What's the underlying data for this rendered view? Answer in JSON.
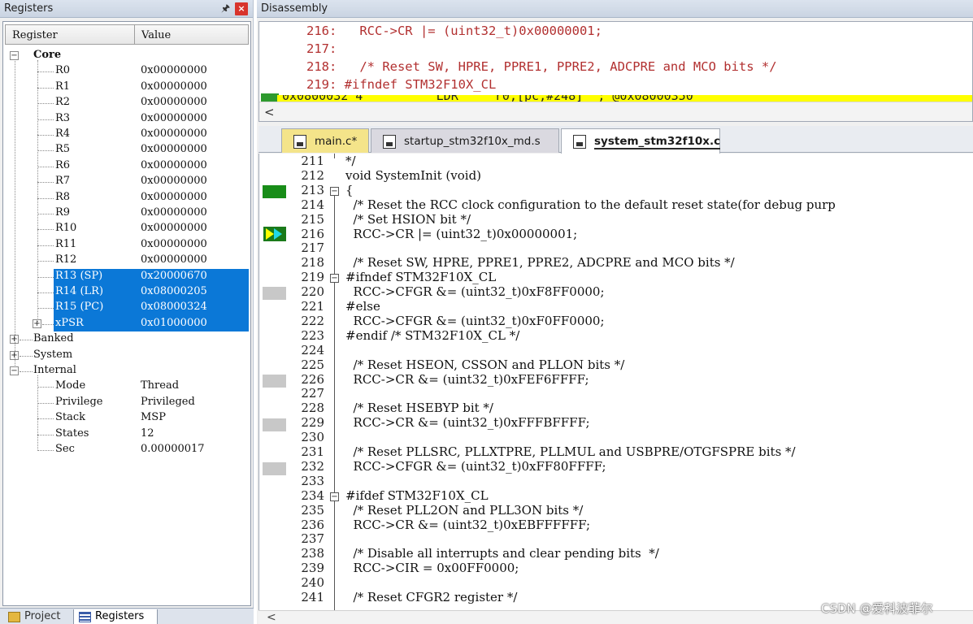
{
  "registers_panel": {
    "title": "Registers",
    "pin_icon": "pin-icon",
    "close_label": "×",
    "columns": {
      "register": "Register",
      "value": "Value"
    },
    "core_label": "Core",
    "core_rows": [
      {
        "name": "R0",
        "value": "0x00000000"
      },
      {
        "name": "R1",
        "value": "0x00000000"
      },
      {
        "name": "R2",
        "value": "0x00000000"
      },
      {
        "name": "R3",
        "value": "0x00000000"
      },
      {
        "name": "R4",
        "value": "0x00000000"
      },
      {
        "name": "R5",
        "value": "0x00000000"
      },
      {
        "name": "R6",
        "value": "0x00000000"
      },
      {
        "name": "R7",
        "value": "0x00000000"
      },
      {
        "name": "R8",
        "value": "0x00000000"
      },
      {
        "name": "R9",
        "value": "0x00000000"
      },
      {
        "name": "R10",
        "value": "0x00000000"
      },
      {
        "name": "R11",
        "value": "0x00000000"
      },
      {
        "name": "R12",
        "value": "0x00000000"
      },
      {
        "name": "R13 (SP)",
        "value": "0x20000670"
      },
      {
        "name": "R14 (LR)",
        "value": "0x08000205"
      },
      {
        "name": "R15 (PC)",
        "value": "0x08000324"
      },
      {
        "name": "xPSR",
        "value": "0x01000000"
      }
    ],
    "groups": {
      "banked": "Banked",
      "system": "System",
      "internal": "Internal"
    },
    "internal_rows": [
      {
        "name": "Mode",
        "value": "Thread"
      },
      {
        "name": "Privilege",
        "value": "Privileged"
      },
      {
        "name": "Stack",
        "value": "MSP"
      },
      {
        "name": "States",
        "value": "12"
      },
      {
        "name": "Sec",
        "value": "0.00000017"
      }
    ],
    "bottom_tabs": {
      "project": "Project",
      "registers": "Registers"
    }
  },
  "disassembly": {
    "title": "Disassembly",
    "lines": [
      "   216:   RCC->CR |= (uint32_t)0x00000001;",
      "   217:",
      "   218:   /* Reset SW, HPRE, PPRE1, PPRE2, ADCPRE and MCO bits */",
      "   219: #ifndef STM32F10X_CL"
    ],
    "highlight_line": "0x0800032 4          LDR     r0,[pc,#248]  ; @0x08000350"
  },
  "file_tabs": [
    "main.c*",
    "startup_stm32f10x_md.s",
    "system_stm32f10x.c"
  ],
  "code": [
    {
      "ln": "211",
      "text": "*/",
      "cls": "c-com"
    },
    {
      "ln": "212",
      "text": "void SystemInit (void)",
      "cls": ""
    },
    {
      "ln": "213",
      "text": "{",
      "cls": ""
    },
    {
      "ln": "214",
      "text": "  /* Reset the RCC clock configuration to the default reset state(for debug purp",
      "cls": "c-com"
    },
    {
      "ln": "215",
      "text": "  /* Set HSION bit */",
      "cls": "c-com"
    },
    {
      "ln": "216",
      "text": "  RCC->CR |= (uint32_t)0x00000001;",
      "cls": ""
    },
    {
      "ln": "217",
      "text": "",
      "cls": ""
    },
    {
      "ln": "218",
      "text": "  /* Reset SW, HPRE, PPRE1, PPRE2, ADCPRE and MCO bits */",
      "cls": "c-com"
    },
    {
      "ln": "219",
      "text": "#ifndef STM32F10X_CL",
      "cls": ""
    },
    {
      "ln": "220",
      "text": "  RCC->CFGR &= (uint32_t)0xF8FF0000;",
      "cls": ""
    },
    {
      "ln": "221",
      "text": "#else",
      "cls": "c-pp"
    },
    {
      "ln": "222",
      "text": "  RCC->CFGR &= (uint32_t)0xF0FF0000;",
      "cls": ""
    },
    {
      "ln": "223",
      "text": "#endif /* STM32F10X_CL */",
      "cls": ""
    },
    {
      "ln": "224",
      "text": "",
      "cls": ""
    },
    {
      "ln": "225",
      "text": "  /* Reset HSEON, CSSON and PLLON bits */",
      "cls": "c-com"
    },
    {
      "ln": "226",
      "text": "  RCC->CR &= (uint32_t)0xFEF6FFFF;",
      "cls": ""
    },
    {
      "ln": "227",
      "text": "",
      "cls": ""
    },
    {
      "ln": "228",
      "text": "  /* Reset HSEBYP bit */",
      "cls": "c-com"
    },
    {
      "ln": "229",
      "text": "  RCC->CR &= (uint32_t)0xFFFBFFFF;",
      "cls": ""
    },
    {
      "ln": "230",
      "text": "",
      "cls": ""
    },
    {
      "ln": "231",
      "text": "  /* Reset PLLSRC, PLLXTPRE, PLLMUL and USBPRE/OTGFSPRE bits */",
      "cls": "c-com"
    },
    {
      "ln": "232",
      "text": "  RCC->CFGR &= (uint32_t)0xFF80FFFF;",
      "cls": ""
    },
    {
      "ln": "233",
      "text": "",
      "cls": ""
    },
    {
      "ln": "234",
      "text": "#ifdef STM32F10X_CL",
      "cls": ""
    },
    {
      "ln": "235",
      "text": "  /* Reset PLL2ON and PLL3ON bits */",
      "cls": "c-com"
    },
    {
      "ln": "236",
      "text": "  RCC->CR &= (uint32_t)0xEBFFFFFF;",
      "cls": ""
    },
    {
      "ln": "237",
      "text": "",
      "cls": ""
    },
    {
      "ln": "238",
      "text": "  /* Disable all interrupts and clear pending bits  */",
      "cls": "c-com"
    },
    {
      "ln": "239",
      "text": "  RCC->CIR = 0x00FF0000;",
      "cls": ""
    },
    {
      "ln": "240",
      "text": "",
      "cls": ""
    },
    {
      "ln": "241",
      "text": "  /* Reset CFGR2 register */",
      "cls": "c-com"
    }
  ],
  "watermark": "CSDN @爱科波菲尔"
}
